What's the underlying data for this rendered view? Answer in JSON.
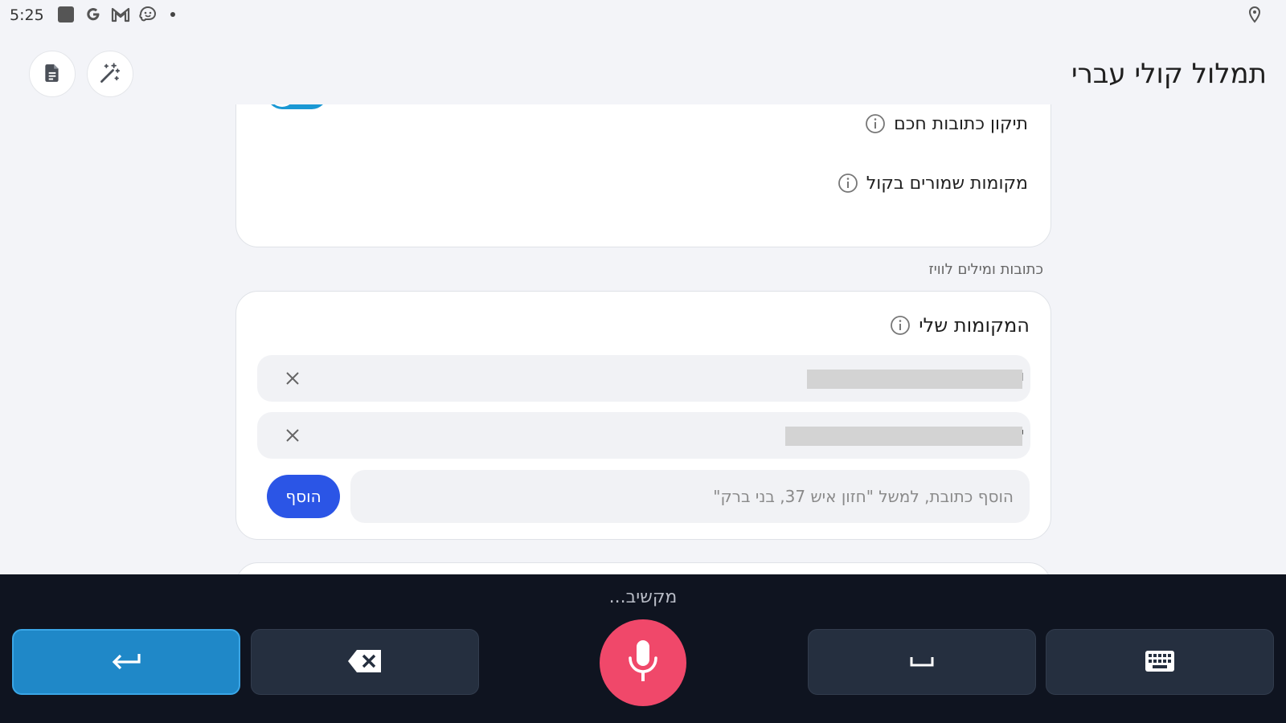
{
  "status_bar": {
    "time": "5:25",
    "icons": [
      "app-square-icon",
      "google-icon",
      "gmail-icon",
      "waze-icon",
      "notification-dot-icon"
    ],
    "right_icon": "location-icon"
  },
  "header": {
    "title": "תמלול קולי עברי",
    "buttons": [
      "document-icon",
      "magic-wand-icon"
    ]
  },
  "settings": {
    "smart_address_fix": {
      "label": "תיקון כתובות חכם",
      "enabled": true
    },
    "saved_places_voice": {
      "label": "מקומות שמורים בקול"
    }
  },
  "section": {
    "label": "כתובות ומילים לוויז"
  },
  "my_places": {
    "title": "המקומות שלי",
    "items": [
      {
        "text": "ו",
        "redacted": true
      },
      {
        "text": "י",
        "redacted": true
      }
    ],
    "add_placeholder": "הוסף כתובת, למשל \"חזון איש 37, בני ברק\"",
    "add_button": "הוסף"
  },
  "voice_input": {
    "status": "מקשיב...",
    "keys": [
      "enter-icon",
      "backspace-icon",
      "microphone-icon",
      "space-icon",
      "keyboard-icon"
    ],
    "colors": {
      "mic": "#f0486a",
      "enter": "#1f88c8",
      "panel": "#0f1420",
      "toggle": "#1a98d4",
      "add_button": "#2b55e6"
    }
  }
}
